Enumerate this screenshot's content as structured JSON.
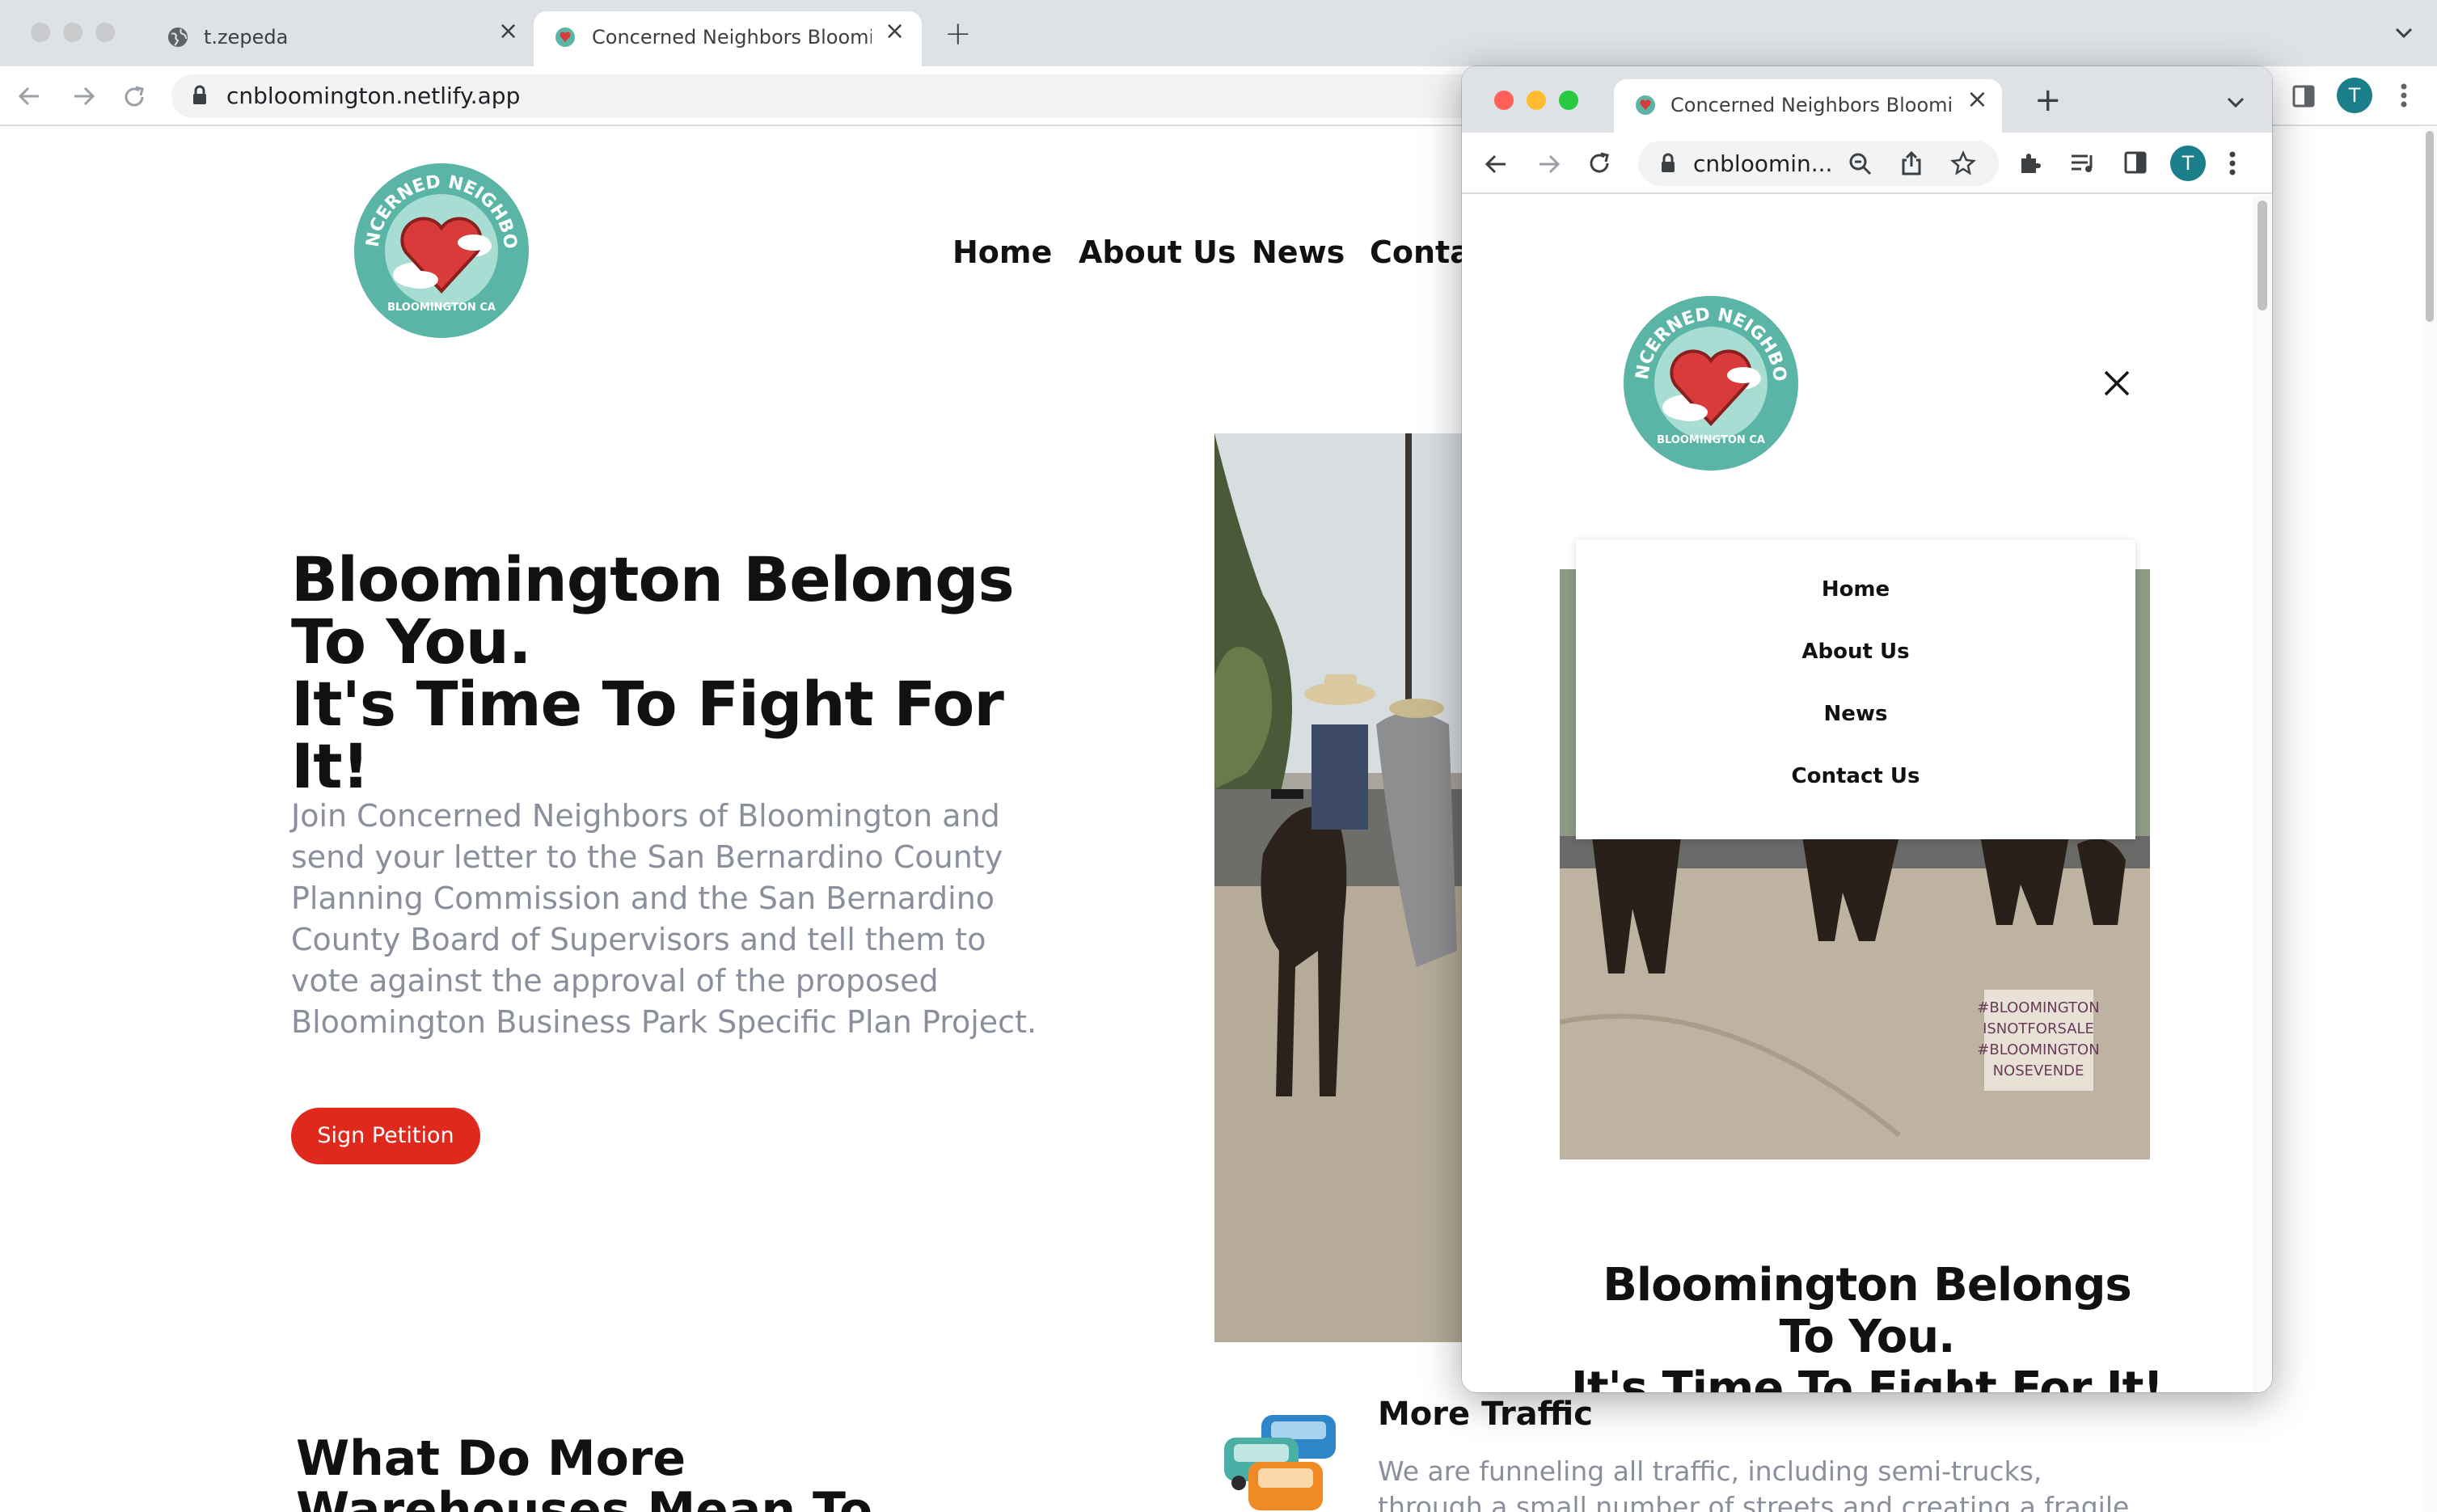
{
  "browser": {
    "tabs": [
      {
        "title": "t.zepeda",
        "active": false
      },
      {
        "title": "Concerned Neighbors Blooming",
        "active": true
      }
    ],
    "url": "cnbloomington.netlify.app",
    "profile_initial": "T"
  },
  "site": {
    "logo": {
      "top_text": "CONCERNED NEIGHBORS",
      "bottom_text": "BLOOMINGTON CA"
    },
    "nav": [
      "Home",
      "About Us",
      "News",
      "Conta"
    ],
    "hero": {
      "title_line1": "Bloomington Belongs",
      "title_line2": "To You.",
      "title_line3": "It's Time To Fight For It!",
      "paragraph": "Join Concerned Neighbors of Bloomington and send your letter to the San Bernardino County Planning Commission and the San Bernardino County Board of Supervisors and tell them to vote against the approval of the proposed Bloomington Business Park Specific Plan Project.",
      "button": "Sign Petition"
    },
    "section_title_line1": "What Do More",
    "section_title_line2": "Warehouses Mean To",
    "traffic": {
      "title": "More Traffic",
      "text_line1": "We are funneling all traffic, including semi-trucks,",
      "text_line2": "through a small number of streets and creating a fragile"
    }
  },
  "popup": {
    "tab_title": "Concerned Neighbors Blooming",
    "url": "cnbloomin...",
    "profile_initial": "T",
    "menu": [
      "Home",
      "About Us",
      "News",
      "Contact Us"
    ],
    "sign_text": [
      "#BLOOMINGTON",
      "ISNOTFORSALE",
      "#BLOOMINGTON",
      "NOSEVENDE"
    ],
    "title_line1": "Bloomington Belongs",
    "title_line2": "To You.",
    "title_line3": "It's Time To Fight For It!"
  },
  "colors": {
    "brand_teal": "#5bb5a6",
    "heart_red": "#d93a3a",
    "button_red": "#e0291c",
    "body_gray": "#8a8f9c"
  }
}
